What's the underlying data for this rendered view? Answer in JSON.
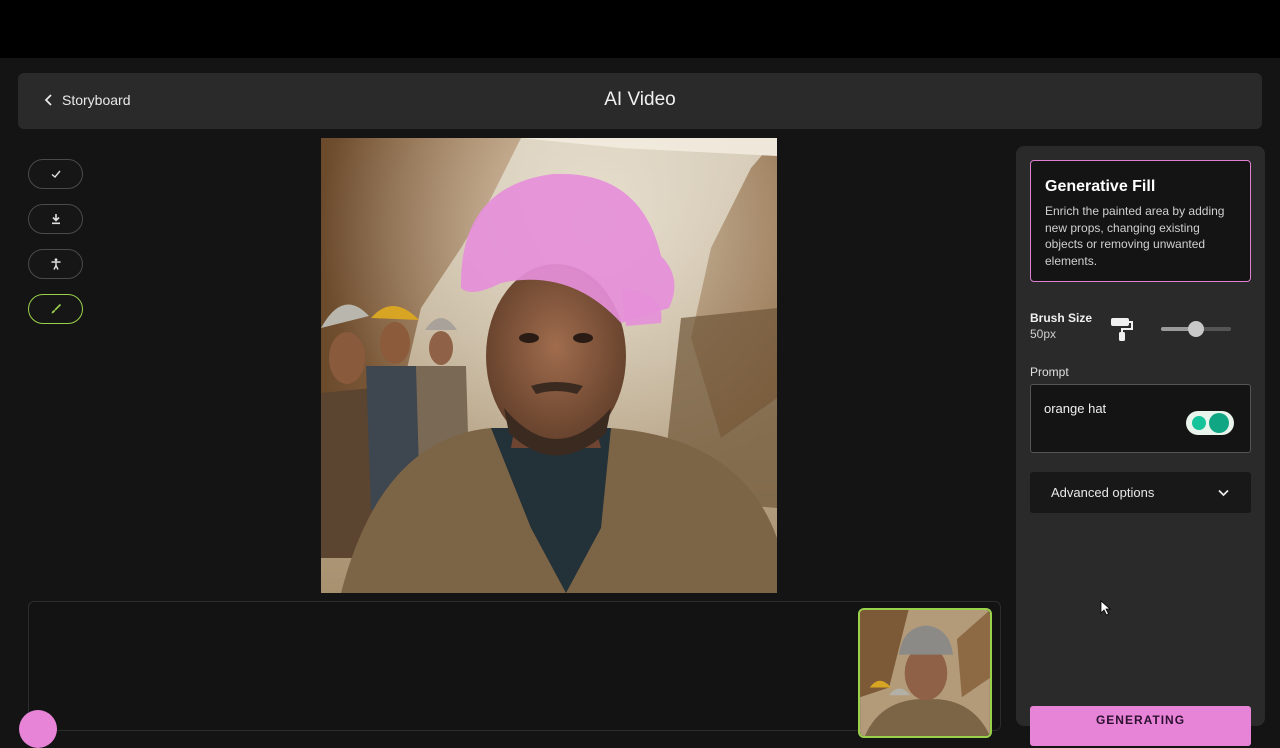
{
  "header": {
    "back_label": "Storyboard",
    "title": "AI Video"
  },
  "tools": [
    {
      "name": "check-icon"
    },
    {
      "name": "download-icon"
    },
    {
      "name": "person-icon"
    },
    {
      "name": "brush-icon",
      "active": true
    }
  ],
  "panel": {
    "generative_fill": {
      "title": "Generative Fill",
      "description": "Enrich the painted area by adding new props, changing existing objects or removing unwanted elements."
    },
    "brush": {
      "label": "Brush Size",
      "value": "50px",
      "level": 0.5
    },
    "prompt": {
      "label": "Prompt",
      "value": "orange hat"
    },
    "advanced_label": "Advanced options",
    "generate_button": "GENERATING"
  },
  "colors": {
    "accent_pink": "#e884d8",
    "active_green": "#9ad14b",
    "panel_bg": "#2a2a2a"
  }
}
